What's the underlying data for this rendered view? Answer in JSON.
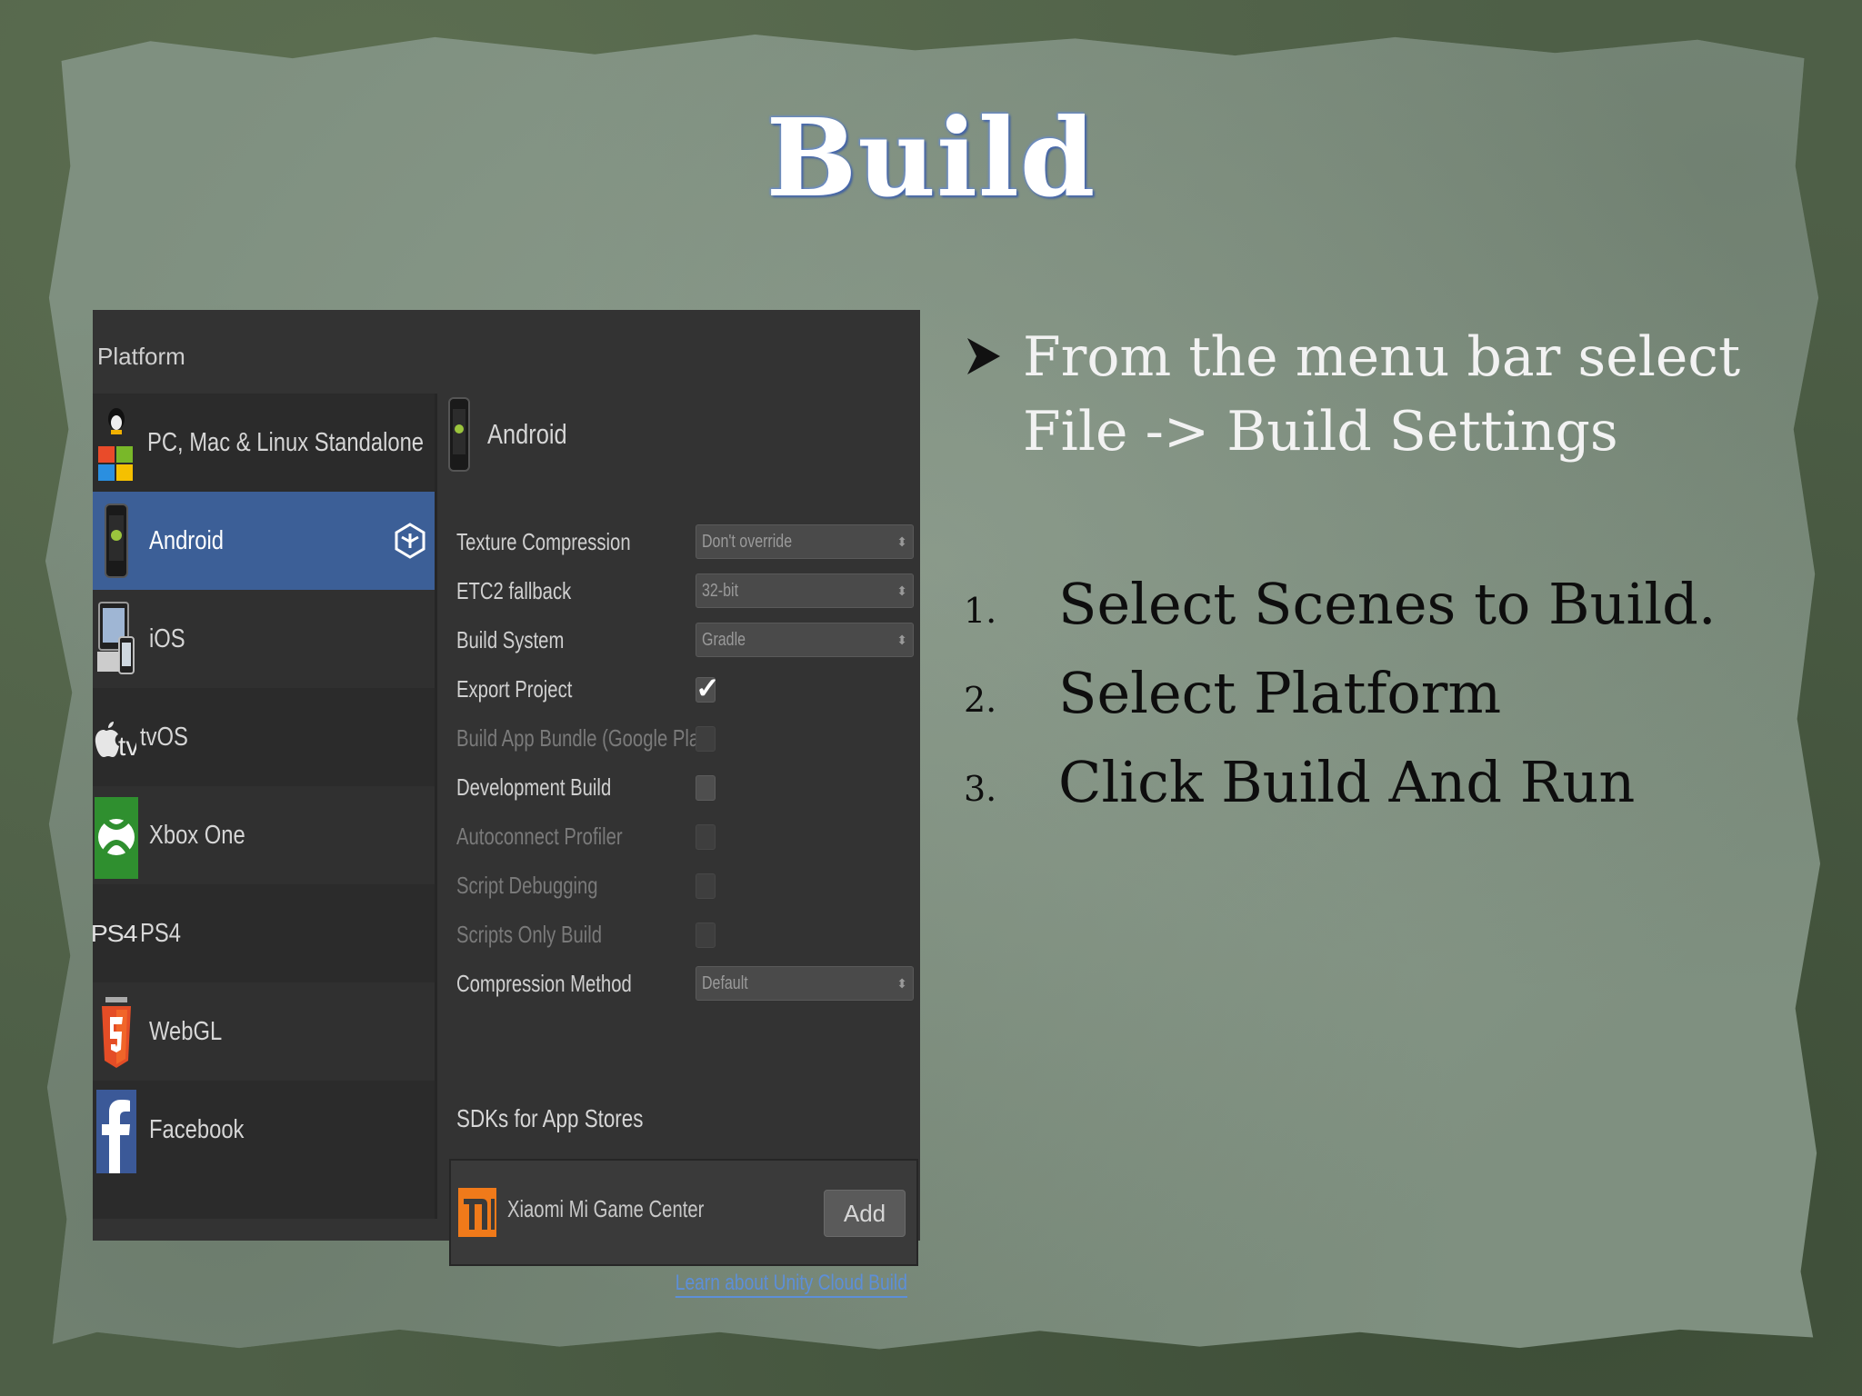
{
  "slide": {
    "title": "Build",
    "bullet_text": "From the menu bar select File -> Build Settings",
    "steps": [
      {
        "num": "1.",
        "text": "Select Scenes to Build."
      },
      {
        "num": "2.",
        "text": "Select Platform"
      },
      {
        "num": "3.",
        "text": "Click Build And Run"
      }
    ]
  },
  "build_settings": {
    "platform_header": "Platform",
    "platforms": [
      {
        "label": "PC, Mac & Linux Standalone",
        "icon": "standalone-icon"
      },
      {
        "label": "Android",
        "icon": "android-icon",
        "selected": true
      },
      {
        "label": "iOS",
        "icon": "ios-icon"
      },
      {
        "label": "tvOS",
        "icon": "appletv-icon"
      },
      {
        "label": "Xbox One",
        "icon": "xbox-icon"
      },
      {
        "label": "PS4",
        "icon": "ps4-icon"
      },
      {
        "label": "WebGL",
        "icon": "html5-icon"
      },
      {
        "label": "Facebook",
        "icon": "facebook-icon"
      }
    ],
    "selected_platform": "Android",
    "ps4_logo": "PS4",
    "tv_logo": "tv",
    "settings": {
      "texture_compression": {
        "label": "Texture Compression",
        "value": "Don't override"
      },
      "etc2_fallback": {
        "label": "ETC2 fallback",
        "value": "32-bit"
      },
      "build_system": {
        "label": "Build System",
        "value": "Gradle"
      },
      "export_project": {
        "label": "Export Project",
        "checked": true
      },
      "build_app_bundle": {
        "label": "Build App Bundle (Google Play)",
        "checked": false
      },
      "development_build": {
        "label": "Development Build",
        "checked": false
      },
      "autoconnect_profiler": {
        "label": "Autoconnect Profiler",
        "checked": false
      },
      "script_debugging": {
        "label": "Script Debugging",
        "checked": false
      },
      "scripts_only_build": {
        "label": "Scripts Only Build",
        "checked": false
      },
      "compression_method": {
        "label": "Compression Method",
        "value": "Default"
      }
    },
    "sdk_header": "SDKs for App Stores",
    "sdk_item": "Xiaomi Mi Game Center",
    "add_label": "Add",
    "learn_link": "Learn about Unity Cloud Build"
  },
  "colors": {
    "selected_row": "#3c5f97",
    "link": "#5d8fd8",
    "title_glow": "#3b5b9e"
  }
}
